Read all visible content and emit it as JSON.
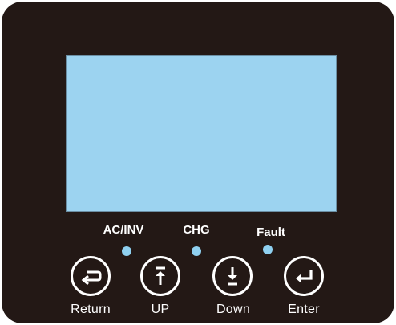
{
  "colors": {
    "panel": "#231815",
    "screen": "#9cd3f0",
    "led": "#8fd0f0",
    "text": "#ffffff"
  },
  "indicators": [
    {
      "label": "AC/INV"
    },
    {
      "label": "CHG"
    },
    {
      "label": "Fault"
    }
  ],
  "buttons": [
    {
      "label": "Return",
      "icon": "return-icon"
    },
    {
      "label": "UP",
      "icon": "arrow-up-icon"
    },
    {
      "label": "Down",
      "icon": "arrow-down-icon"
    },
    {
      "label": "Enter",
      "icon": "enter-icon"
    }
  ]
}
